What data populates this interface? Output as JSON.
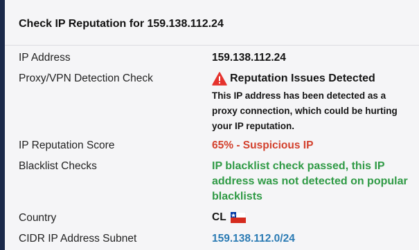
{
  "card": {
    "title": "Check IP Reputation for 159.138.112.24"
  },
  "rows": {
    "ip_address": {
      "label": "IP Address",
      "value": "159.138.112.24"
    },
    "proxy_check": {
      "label": "Proxy/VPN Detection Check",
      "status_title": "Reputation Issues Detected",
      "status_icon": "warning-triangle-icon",
      "description_lines": [
        "This IP address has been detected as a",
        "proxy connection, which could be hurting",
        "your IP reputation."
      ]
    },
    "reputation_score": {
      "label": "IP Reputation Score",
      "value": "65% - Suspicious IP"
    },
    "blacklist": {
      "label": "Blacklist Checks",
      "value_lines": [
        "IP blacklist check passed, this IP",
        "address was not detected on popular",
        "blacklists"
      ]
    },
    "country": {
      "label": "Country",
      "code": "CL",
      "flag_icon": "chile-flag-icon"
    },
    "cidr": {
      "label": "CIDR IP Address Subnet",
      "value": "159.138.112.0/24"
    }
  },
  "colors": {
    "warning": "#e5322d",
    "suspicious": "#d3402c",
    "passed": "#2f9a45",
    "link": "#2b7bb4"
  }
}
